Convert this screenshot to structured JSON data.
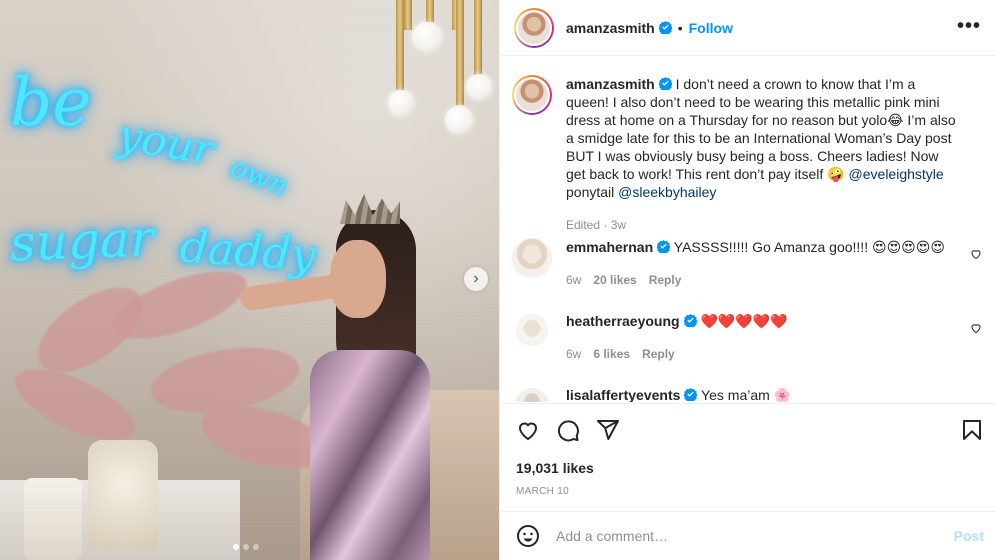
{
  "post": {
    "username": "amanzasmith",
    "follow_label": "Follow",
    "separator": "•",
    "more_label": "•••"
  },
  "photo": {
    "neon_line1": "be",
    "neon_line2": "your",
    "neon_line3": "own",
    "neon_line4": "sugar",
    "neon_line5": "daddy",
    "next_label": "›",
    "slide_count": 3,
    "active_slide": 1
  },
  "caption": {
    "username": "amanzasmith",
    "text": "I don’t need a crown to know that I’m a queen! I also don’t need to be wearing this metallic pink mini dress at home on a Thursday for no reason but yolo😂 I’m also a smidge late for this to be an International Woman’s Day post BUT I was obviously busy being a boss. Cheers ladies! Now get back to work! This rent don’t pay itself 🤪",
    "mention1": "@eveleighstyle",
    "between": " ponytail ",
    "mention2": "@sleekbyhailey",
    "meta": "Edited · 3w"
  },
  "comments": [
    {
      "username": "emmahernan",
      "text": "YASSSS!!!!! Go Amanza goo!!!! 😍😍😍😍😍",
      "time": "6w",
      "likes": "20 likes",
      "reply": "Reply"
    },
    {
      "username": "heatherraeyoung",
      "text": "❤️❤️❤️❤️❤️",
      "time": "6w",
      "likes": "6 likes",
      "reply": "Reply"
    },
    {
      "username": "lisalaffertyevents",
      "text": "Yes ma’am 🌸"
    }
  ],
  "actions": {
    "likes": "19,031 likes",
    "date": "MARCH 10"
  },
  "add_comment": {
    "placeholder": "Add a comment…",
    "post_label": "Post"
  },
  "colors": {
    "accent": "#0095f6",
    "mention": "#00376b",
    "muted": "#8e8e8e",
    "post_disabled": "#b2dffc"
  }
}
